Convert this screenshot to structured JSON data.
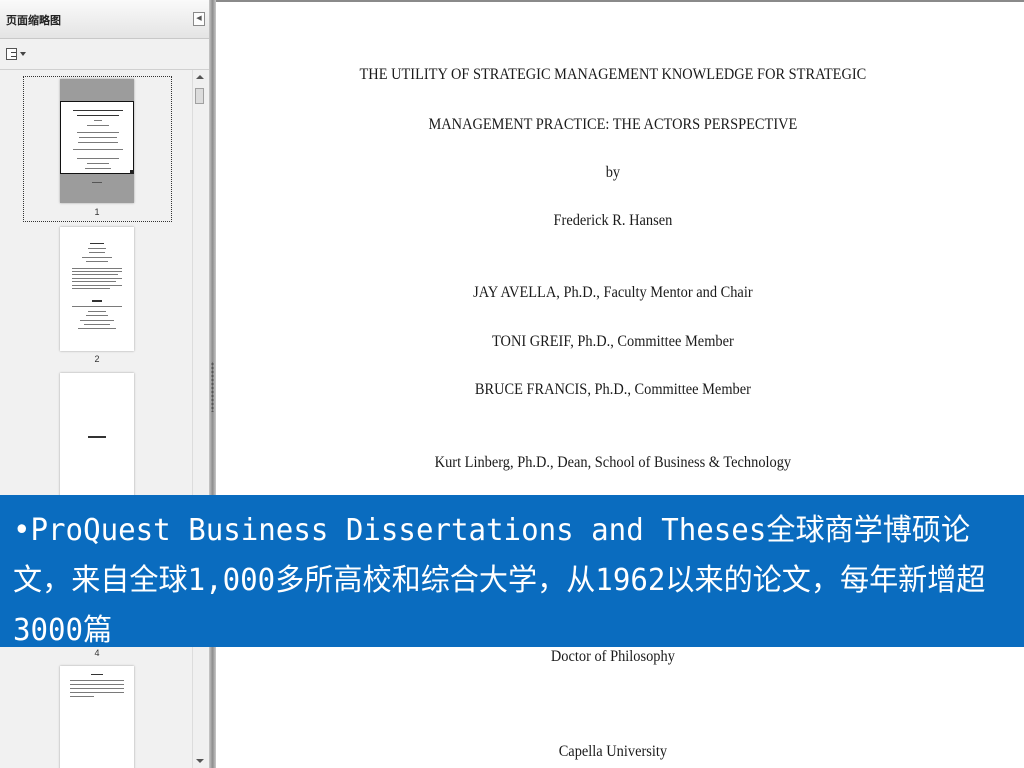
{
  "sidebar": {
    "title": "页面缩略图",
    "collapse_icon": "collapse-left-icon",
    "options_icon": "thumbnail-options-icon",
    "thumbnails": [
      {
        "label": "1"
      },
      {
        "label": "2"
      },
      {
        "label": "4"
      }
    ]
  },
  "document": {
    "title_line1": "THE UTILITY OF STRATEGIC MANAGEMENT KNOWLEDGE FOR STRATEGIC",
    "title_line2": "MANAGEMENT PRACTICE: THE ACTORS PERSPECTIVE",
    "by": "by",
    "author": "Frederick R. Hansen",
    "committee": [
      "JAY AVELLA, Ph.D., Faculty Mentor and Chair",
      "TONI GREIF, Ph.D., Committee Member",
      "BRUCE FRANCIS, Ph.D., Committee Member"
    ],
    "dean": "Kurt Linberg, Ph.D., Dean, School of Business & Technology",
    "degree": "Doctor of Philosophy",
    "university": "Capella University"
  },
  "banner": {
    "text": "•ProQuest Business Dissertations and Theses全球商学博硕论文，来自全球1,000多所高校和综合大学，从1962以来的论文，每年新增超3000篇",
    "background": "#0a6cbf"
  }
}
